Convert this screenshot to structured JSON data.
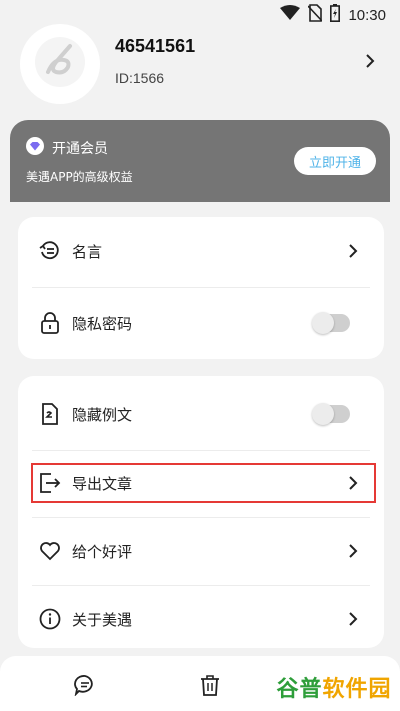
{
  "status_bar": {
    "time": "10:30",
    "icons": [
      "wifi-icon",
      "no-sim-icon",
      "battery-icon"
    ]
  },
  "profile": {
    "username": "46541561",
    "user_id": "ID:1566",
    "avatar_icon": "app-logo-icon"
  },
  "vip": {
    "title": "开通会员",
    "subtitle": "美遇APP的高级权益",
    "button_label": "立即开通",
    "icon": "diamond-icon",
    "accent_color": "#4fb3e8"
  },
  "settings_group_1": [
    {
      "label": "名言",
      "icon": "quote-icon",
      "control": "chevron"
    },
    {
      "label": "隐私密码",
      "icon": "lock-icon",
      "control": "toggle",
      "enabled": false
    }
  ],
  "settings_group_2": [
    {
      "label": "隐藏例文",
      "icon": "document-icon",
      "control": "toggle",
      "enabled": false
    },
    {
      "label": "导出文章",
      "icon": "export-icon",
      "control": "chevron",
      "highlighted": true
    },
    {
      "label": "给个好评",
      "icon": "heart-icon",
      "control": "chevron"
    },
    {
      "label": "关于美遇",
      "icon": "info-icon",
      "control": "chevron"
    }
  ],
  "bottom_nav": {
    "icons": [
      "chat-icon",
      "trash-icon"
    ]
  },
  "watermark": {
    "part1": "谷普",
    "part2": "软件园"
  },
  "colors": {
    "highlight_border": "#e53935",
    "vip_bg": "#757575"
  }
}
